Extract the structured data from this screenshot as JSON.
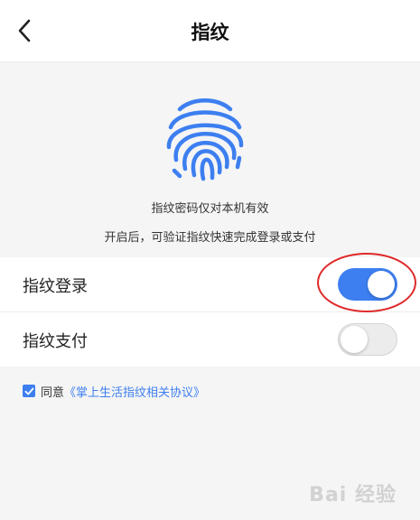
{
  "header": {
    "title": "指纹",
    "back_icon": "chevron-left-icon"
  },
  "hero": {
    "icon": "fingerprint-icon",
    "line1": "指纹密码仅对本机有效",
    "line2": "开启后，可验证指纹快速完成登录或支付"
  },
  "settings": [
    {
      "label": "指纹登录",
      "enabled": true
    },
    {
      "label": "指纹支付",
      "enabled": false
    }
  ],
  "agreement": {
    "checked": true,
    "prefix": "同意",
    "link": "《掌上生活指纹相关协议》"
  },
  "watermark": "Bai 经验",
  "colors": {
    "accent": "#3d7ff0",
    "annotation": "#e02a2a",
    "background": "#f5f5f5"
  }
}
